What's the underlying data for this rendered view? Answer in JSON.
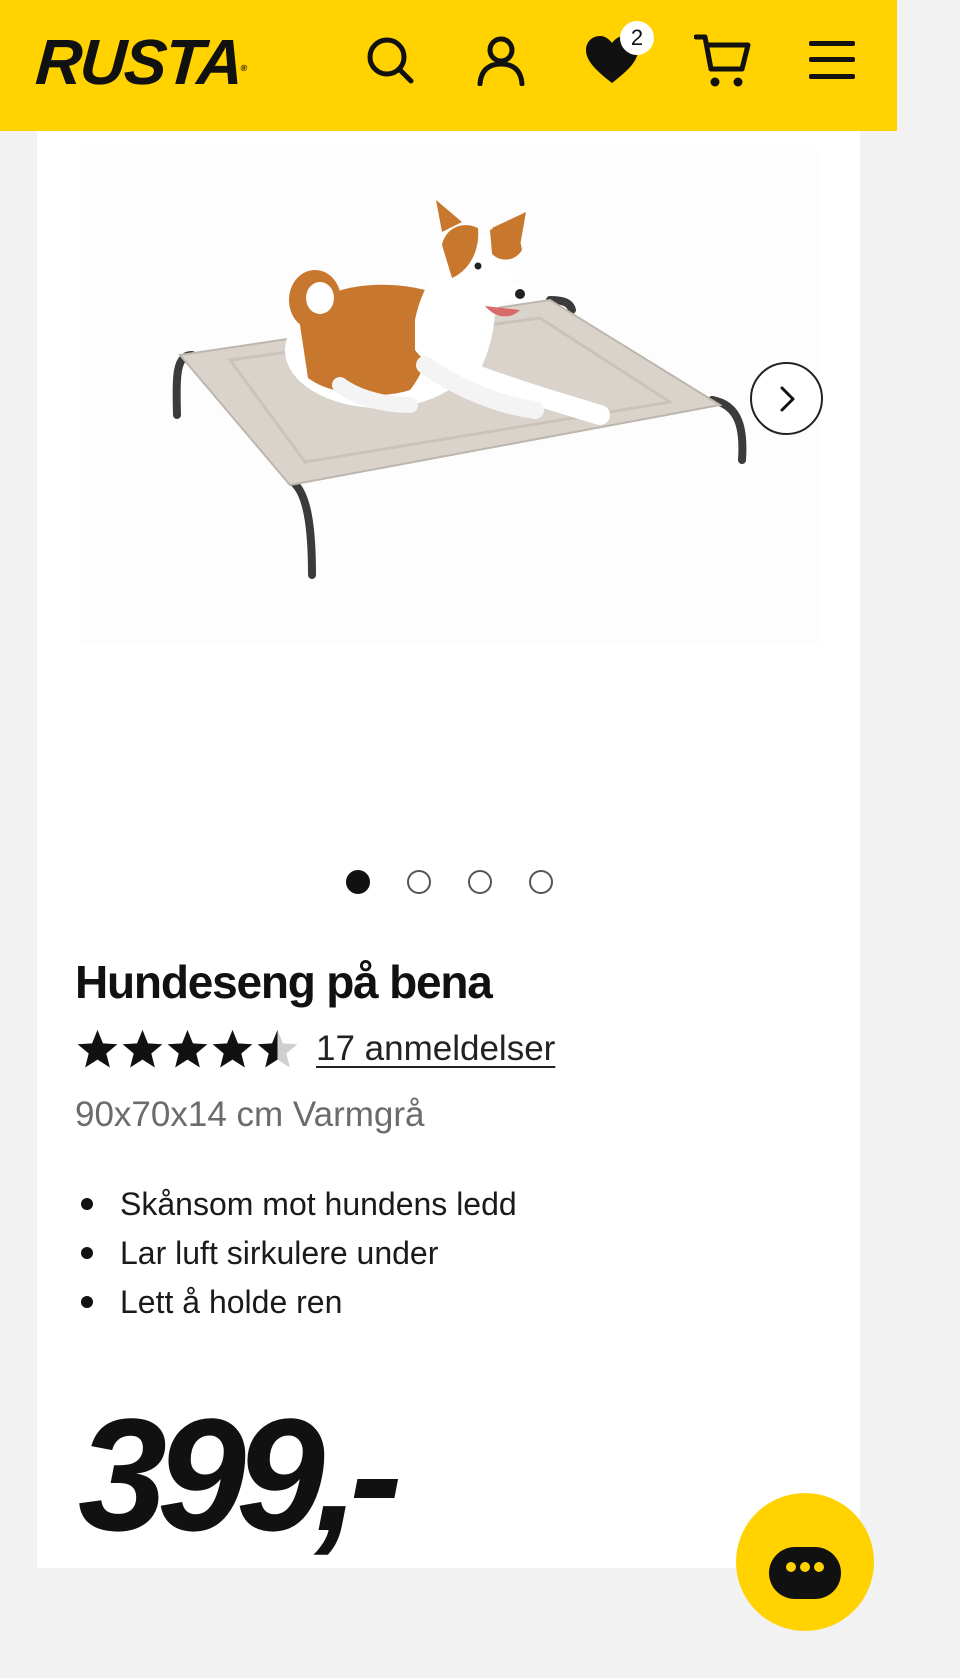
{
  "header": {
    "logo": "RUSTA",
    "logo_mark": "®",
    "icons": {
      "search": "search-icon",
      "account": "user-icon",
      "wishlist": "heart-icon",
      "cart": "cart-icon",
      "menu": "hamburger-menu-icon"
    },
    "wishlist_count": "2",
    "accent_color": "#ffd200"
  },
  "gallery": {
    "image_alt": "dog-bed-with-dog-image",
    "next_icon": "chevron-right-icon",
    "dot_count": 4,
    "active_index": 0
  },
  "product": {
    "title": "Hundeseng på bena",
    "rating": 4.5,
    "rating_max": 5,
    "reviews_link": "17 anmeldelser",
    "variant": "90x70x14 cm Varmgrå",
    "features": [
      "Skånsom mot hundens ledd",
      "Lar luft sirkulere under",
      "Lett å holde ren"
    ],
    "price": "399,-"
  },
  "chat": {
    "icon": "chat-bubble-icon"
  }
}
